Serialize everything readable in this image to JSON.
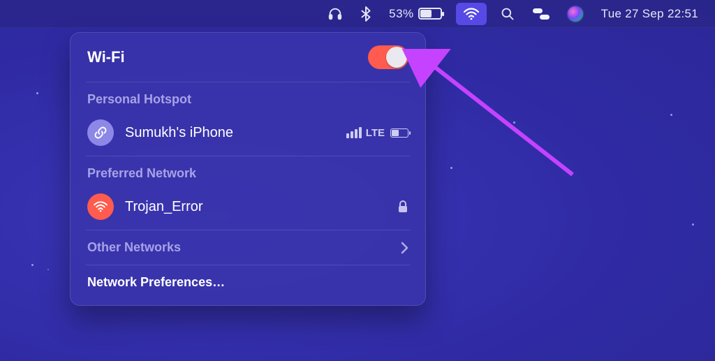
{
  "menubar": {
    "battery_percent": "53%",
    "battery_fill_pct": 53,
    "clock": "Tue 27 Sep  22:51"
  },
  "panel": {
    "title": "Wi-Fi",
    "toggle_on": true,
    "sections": {
      "hotspot_label": "Personal Hotspot",
      "preferred_label": "Preferred Network",
      "other_label": "Other Networks",
      "prefs_label": "Network Preferences…"
    },
    "hotspot": {
      "name": "Sumukh's iPhone",
      "cell_type": "LTE",
      "signal_bars": 4,
      "battery_fill_pct": 40
    },
    "preferred": {
      "name": "Trojan_Error",
      "locked": true
    }
  },
  "colors": {
    "accent": "#5749e6",
    "toggle_on": "#ff5b4e",
    "annotation": "#c542ff"
  }
}
